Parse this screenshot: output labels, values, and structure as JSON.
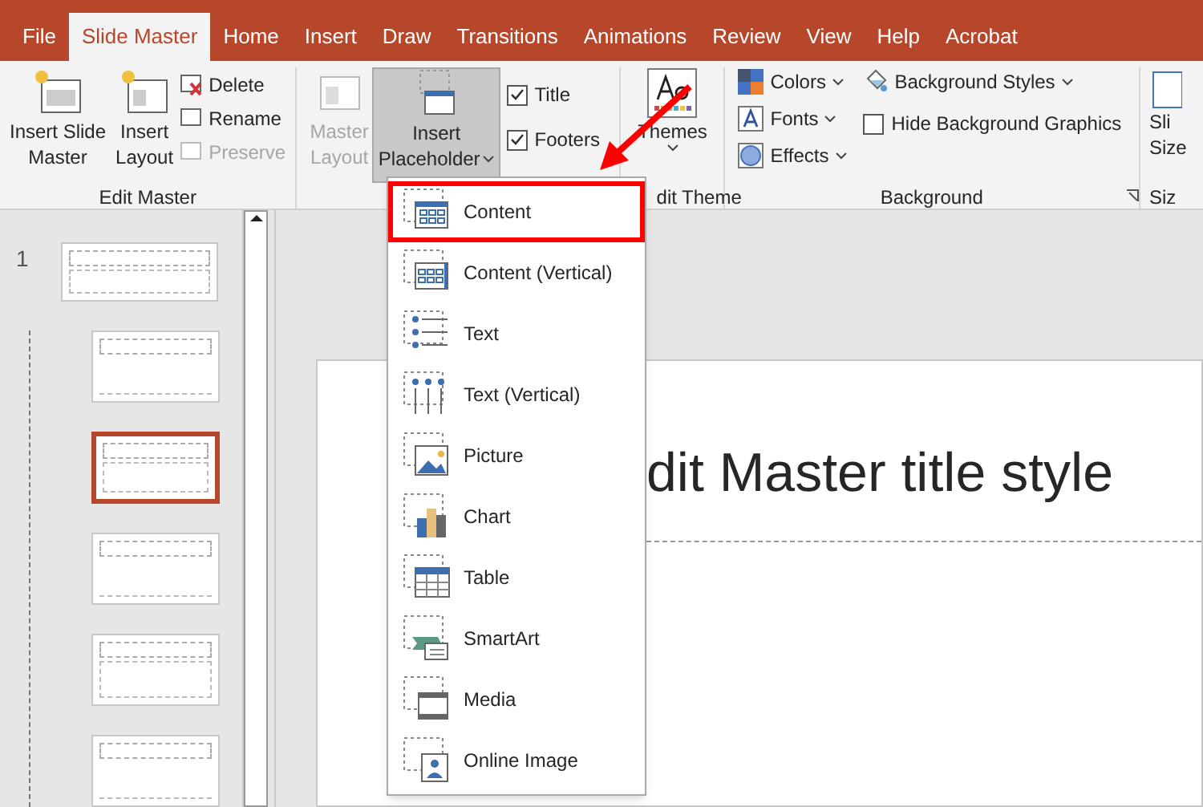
{
  "tabs": [
    {
      "label": "File",
      "selected": false
    },
    {
      "label": "Slide Master",
      "selected": true
    },
    {
      "label": "Home",
      "selected": false
    },
    {
      "label": "Insert",
      "selected": false
    },
    {
      "label": "Draw",
      "selected": false
    },
    {
      "label": "Transitions",
      "selected": false
    },
    {
      "label": "Animations",
      "selected": false
    },
    {
      "label": "Review",
      "selected": false
    },
    {
      "label": "View",
      "selected": false
    },
    {
      "label": "Help",
      "selected": false
    },
    {
      "label": "Acrobat",
      "selected": false
    }
  ],
  "ribbon": {
    "edit_master": {
      "label": "Edit Master",
      "insert_slide_master": [
        "Insert Slide",
        "Master"
      ],
      "insert_layout": [
        "Insert",
        "Layout"
      ],
      "small": [
        {
          "label": "Delete",
          "disabled": false
        },
        {
          "label": "Rename",
          "disabled": false
        },
        {
          "label": "Preserve",
          "disabled": true
        }
      ]
    },
    "master_layout": {
      "label": [
        "Master",
        "Layout"
      ],
      "disabled": true,
      "insert_placeholder": [
        "Insert",
        "Placeholder"
      ],
      "pressed": true,
      "checks": [
        {
          "label": "Title",
          "checked": true
        },
        {
          "label": "Footers",
          "checked": true
        }
      ]
    },
    "edit_theme": {
      "label": "dit Theme",
      "themes": "Themes"
    },
    "background": {
      "label": "Background",
      "items": [
        {
          "label": "Colors"
        },
        {
          "label": "Fonts"
        },
        {
          "label": "Effects"
        }
      ],
      "styles": "Background Styles",
      "hide": {
        "label": "Hide Background Graphics",
        "checked": false
      }
    },
    "size": {
      "label": [
        "Sli",
        "Size"
      ],
      "group": "Siz"
    }
  },
  "thumbnails": {
    "number": "1",
    "selected": false,
    "children": [
      {
        "selected": false
      },
      {
        "selected": true
      },
      {
        "selected": false
      },
      {
        "selected": false
      },
      {
        "selected": false
      }
    ]
  },
  "slide": {
    "title": "dit Master title style"
  },
  "menu": [
    {
      "kind": "content",
      "label": "Content",
      "selected": true
    },
    {
      "kind": "content_vertical",
      "label": "Content (Vertical)",
      "selected": false
    },
    {
      "kind": "text",
      "label": "Text",
      "selected": false
    },
    {
      "kind": "text_vertical",
      "label": "Text (Vertical)",
      "selected": false
    },
    {
      "kind": "picture",
      "label": "Picture",
      "selected": false
    },
    {
      "kind": "chart",
      "label": "Chart",
      "selected": false
    },
    {
      "kind": "table",
      "label": "Table",
      "selected": false
    },
    {
      "kind": "smartart",
      "label": "SmartArt",
      "selected": false
    },
    {
      "kind": "media",
      "label": "Media",
      "selected": false
    },
    {
      "kind": "online_image",
      "label": "Online Image",
      "selected": false
    }
  ]
}
